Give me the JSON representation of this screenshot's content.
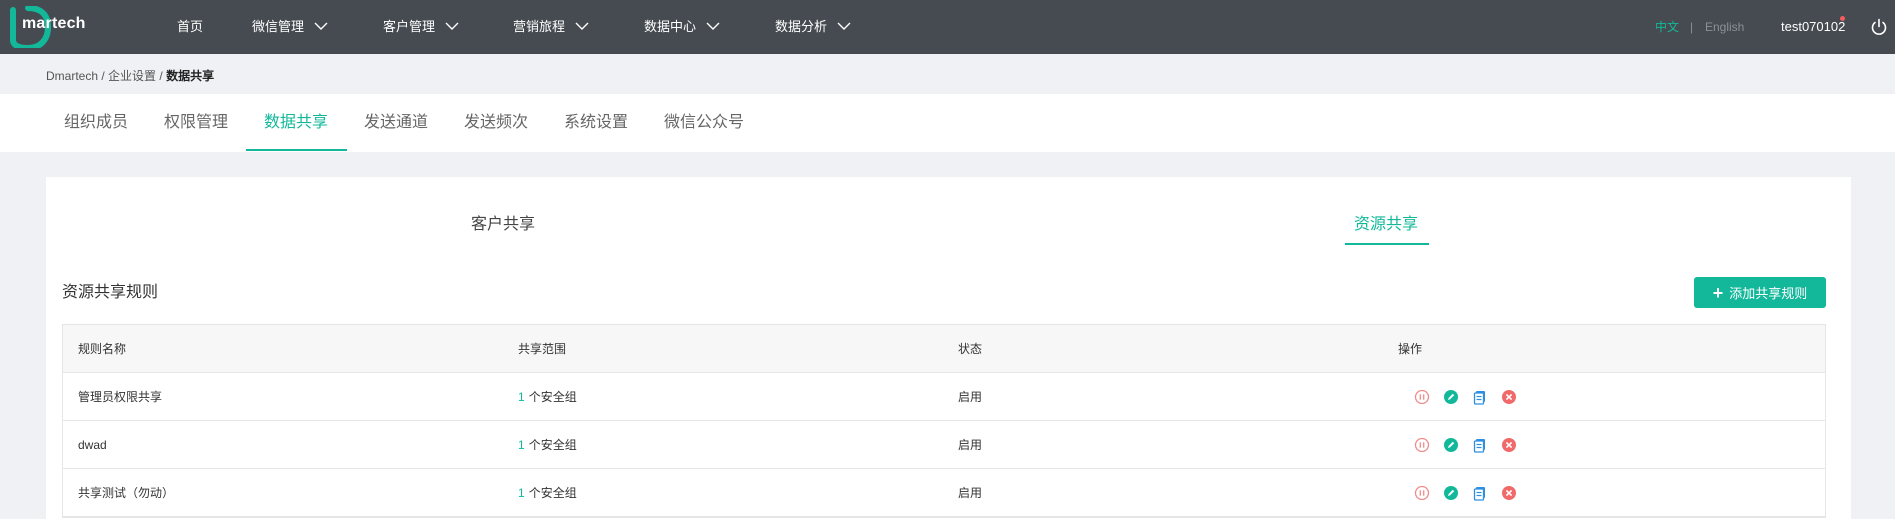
{
  "header": {
    "logo_text": "martech",
    "nav": [
      {
        "label": "首页",
        "has_dropdown": false
      },
      {
        "label": "微信管理",
        "has_dropdown": true
      },
      {
        "label": "客户管理",
        "has_dropdown": true
      },
      {
        "label": "营销旅程",
        "has_dropdown": true
      },
      {
        "label": "数据中心",
        "has_dropdown": true
      },
      {
        "label": "数据分析",
        "has_dropdown": true
      }
    ],
    "lang_zh": "中文",
    "lang_sep": "|",
    "lang_en": "English",
    "username": "test070102",
    "icons": {
      "power": "power-icon",
      "chevron": "chevron-down-icon"
    }
  },
  "breadcrumb": {
    "root": "Dmartech",
    "sep1": " / ",
    "parent": "企业设置",
    "sep2": " / ",
    "current": "数据共享"
  },
  "settings_tabs": [
    {
      "label": "组织成员",
      "active": false
    },
    {
      "label": "权限管理",
      "active": false
    },
    {
      "label": "数据共享",
      "active": true
    },
    {
      "label": "发送通道",
      "active": false
    },
    {
      "label": "发送频次",
      "active": false
    },
    {
      "label": "系统设置",
      "active": false
    },
    {
      "label": "微信公众号",
      "active": false
    }
  ],
  "sub_tabs": [
    {
      "label": "客户共享",
      "active": false
    },
    {
      "label": "资源共享",
      "active": true
    }
  ],
  "section": {
    "title": "资源共享规则",
    "add_button": "添加共享规则"
  },
  "table": {
    "columns": [
      "规则名称",
      "共享范围",
      "状态",
      "操作"
    ],
    "rows": [
      {
        "name": "管理员权限共享",
        "scope_count": "1",
        "scope_text": "个安全组",
        "status": "启用"
      },
      {
        "name": "dwad",
        "scope_count": "1",
        "scope_text": "个安全组",
        "status": "启用"
      },
      {
        "name": "共享测试（勿动）",
        "scope_count": "1",
        "scope_text": "个安全组",
        "status": "启用"
      }
    ],
    "action_icons": [
      "pause-icon",
      "edit-icon",
      "copy-icon",
      "delete-icon"
    ]
  },
  "colors": {
    "accent": "#13b89a",
    "topbar": "#454b50",
    "pause": "#f08c8c",
    "delete": "#f06a6a",
    "copy": "#2f8fe0"
  }
}
